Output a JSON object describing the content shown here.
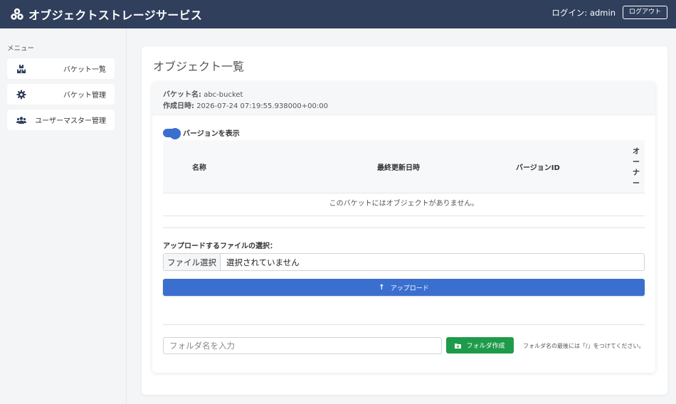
{
  "app": {
    "title": "オブジェクトストレージサービス",
    "brand_icon": "boxes-icon",
    "login_text": "ログイン: admin",
    "logout_label": "ログアウト",
    "header_color": "#2f3f5c"
  },
  "sidebar": {
    "heading": "メニュー",
    "items": [
      {
        "label": "バケット一覧",
        "icon": "boxes-icon"
      },
      {
        "label": "バケット管理",
        "icon": "gear-icon"
      },
      {
        "label": "ユーザーマスター管理",
        "icon": "users-icon"
      }
    ]
  },
  "main": {
    "page_title": "オブジェクト一覧",
    "bucket_name_label": "バケット名:",
    "bucket_name_value": "abc-bucket",
    "created_label": "作成日時:",
    "created_value": "2026-07-24 07:19:55.938000+00:00",
    "show_versions_label": "バージョンを表示",
    "show_versions_on": true,
    "table": {
      "columns": [
        "名称",
        "最終更新日時",
        "バージョンID",
        "オーナー"
      ],
      "empty_message": "このバケットにはオブジェクトがありません。"
    },
    "upload": {
      "label": "アップロードするファイルの選択：",
      "file_button": "ファイル選択",
      "file_status": "選択されていません",
      "upload_button": "アップロード",
      "upload_icon": "arrow-up-icon"
    },
    "folder": {
      "placeholder": "フォルダ名を入力",
      "create_button": "フォルダ作成",
      "create_icon": "folder-plus-icon",
      "note": "フォルダ名の最後には「/」をつけてください。"
    }
  },
  "colors": {
    "primary": "#3b6fcf",
    "success": "#1e9b4a"
  }
}
